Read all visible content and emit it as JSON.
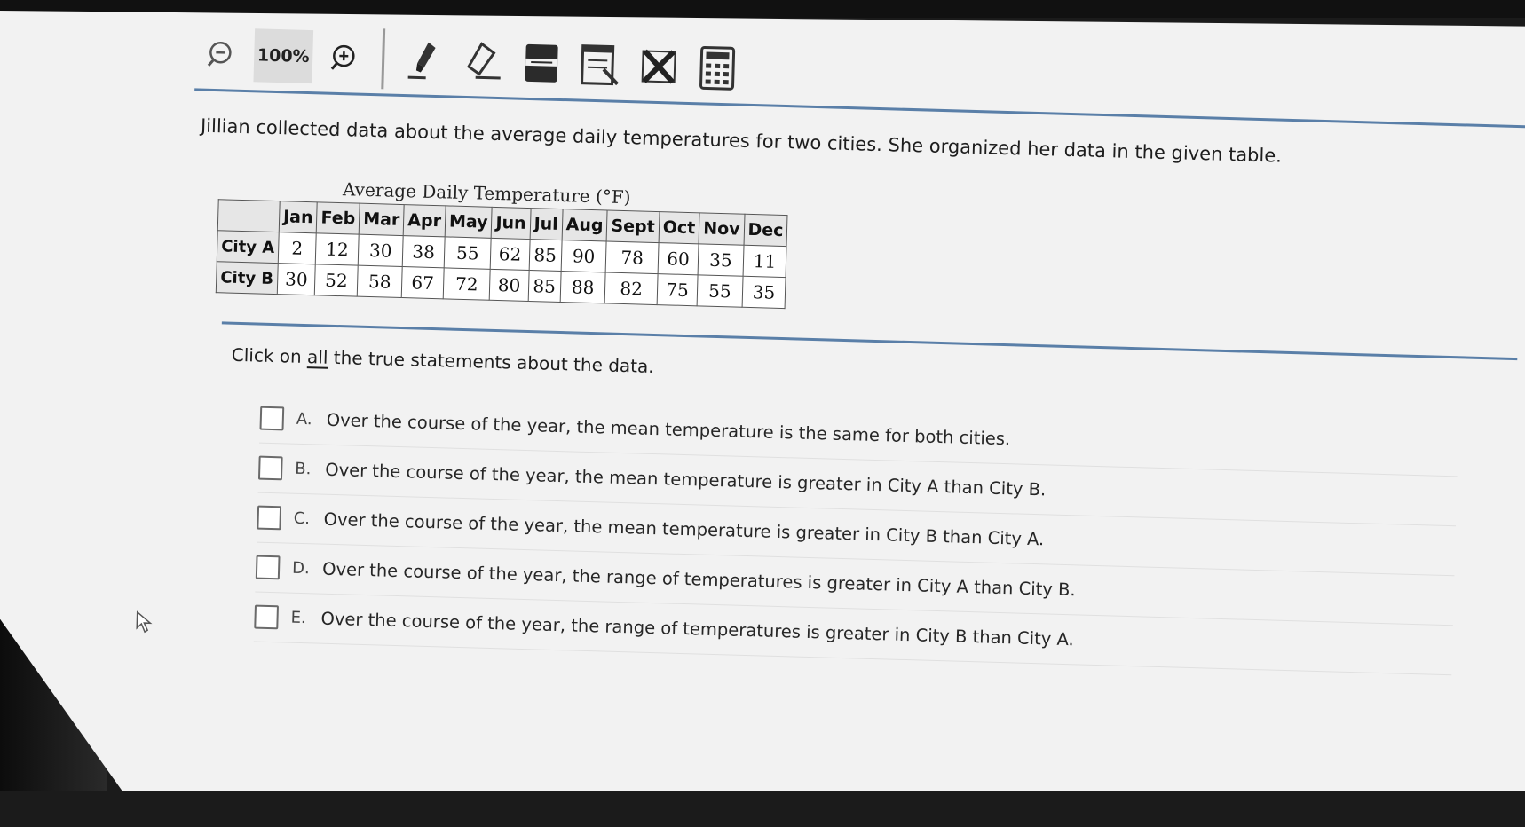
{
  "toolbar": {
    "zoom_level": "100%",
    "icons": [
      "zoom-out-icon",
      "zoom-in-icon",
      "highlighter-icon",
      "eraser-icon",
      "line-reader-icon",
      "notepad-icon",
      "answer-eliminator-icon",
      "calculator-icon"
    ]
  },
  "question": {
    "prompt": "Jillian collected data about the average daily temperatures for two cities. She organized her data in the given table.",
    "table": {
      "caption": "Average Daily Temperature (°F)",
      "columns": [
        "",
        "Jan",
        "Feb",
        "Mar",
        "Apr",
        "May",
        "Jun",
        "Jul",
        "Aug",
        "Sept",
        "Oct",
        "Nov",
        "Dec"
      ],
      "rows": [
        {
          "label": "City A",
          "values": [
            "2",
            "12",
            "30",
            "38",
            "55",
            "62",
            "85",
            "90",
            "78",
            "60",
            "35",
            "11"
          ]
        },
        {
          "label": "City B",
          "values": [
            "30",
            "52",
            "58",
            "67",
            "72",
            "80",
            "85",
            "88",
            "82",
            "75",
            "55",
            "35"
          ]
        }
      ]
    },
    "instruction_pre": "Click on ",
    "instruction_emph": "all",
    "instruction_post": " the true statements about the data.",
    "options": [
      {
        "letter": "A.",
        "text": "Over the course of the year, the mean temperature is the same for both cities."
      },
      {
        "letter": "B.",
        "text": "Over the course of the year, the mean temperature is greater in City A than City B."
      },
      {
        "letter": "C.",
        "text": "Over the course of the year, the mean temperature is greater in City B than City A."
      },
      {
        "letter": "D.",
        "text": "Over the course of the year, the range of temperatures is greater in City A than City B."
      },
      {
        "letter": "E.",
        "text": "Over the course of the year, the range of temperatures is greater in City B than City A."
      }
    ]
  }
}
